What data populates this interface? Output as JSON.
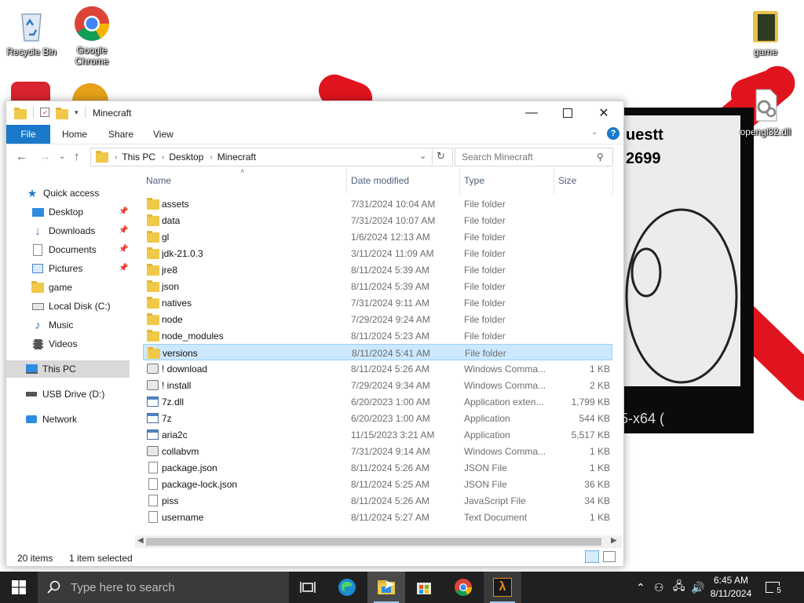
{
  "desktop": {
    "icons": [
      {
        "label": "Recycle Bin"
      },
      {
        "label": "Google Chrome"
      },
      {
        "label": "game"
      },
      {
        "label": "opengl32.dll"
      }
    ],
    "bg_window": {
      "line1": "uestt",
      "line2": "2699",
      "bottom": "5-x64 ("
    }
  },
  "explorer": {
    "title": "Minecraft",
    "ribbon_tabs": [
      "File",
      "Home",
      "Share",
      "View"
    ],
    "address": {
      "crumbs": [
        "This PC",
        "Desktop",
        "Minecraft"
      ]
    },
    "search_placeholder": "Search Minecraft",
    "nav": {
      "quick_access": "Quick access",
      "items": [
        {
          "label": "Desktop",
          "pinned": true
        },
        {
          "label": "Downloads",
          "pinned": true
        },
        {
          "label": "Documents",
          "pinned": true
        },
        {
          "label": "Pictures",
          "pinned": true
        },
        {
          "label": "game",
          "pinned": false
        },
        {
          "label": "Local Disk (C:)",
          "pinned": false
        },
        {
          "label": "Music",
          "pinned": false
        },
        {
          "label": "Videos",
          "pinned": false
        }
      ],
      "this_pc": "This PC",
      "usb": "USB Drive (D:)",
      "network": "Network"
    },
    "columns": {
      "name": "Name",
      "date": "Date modified",
      "type": "Type",
      "size": "Size"
    },
    "files": [
      {
        "name": "assets",
        "date": "7/31/2024 10:04 AM",
        "type": "File folder",
        "size": "",
        "icon": "folder"
      },
      {
        "name": "data",
        "date": "7/31/2024 10:07 AM",
        "type": "File folder",
        "size": "",
        "icon": "folder"
      },
      {
        "name": "gl",
        "date": "1/6/2024 12:13 AM",
        "type": "File folder",
        "size": "",
        "icon": "folder"
      },
      {
        "name": "jdk-21.0.3",
        "date": "3/11/2024 11:09 AM",
        "type": "File folder",
        "size": "",
        "icon": "folder"
      },
      {
        "name": "jre8",
        "date": "8/11/2024 5:39 AM",
        "type": "File folder",
        "size": "",
        "icon": "folder"
      },
      {
        "name": "json",
        "date": "8/11/2024 5:39 AM",
        "type": "File folder",
        "size": "",
        "icon": "folder"
      },
      {
        "name": "natives",
        "date": "7/31/2024 9:11 AM",
        "type": "File folder",
        "size": "",
        "icon": "folder"
      },
      {
        "name": "node",
        "date": "7/29/2024 9:24 AM",
        "type": "File folder",
        "size": "",
        "icon": "folder"
      },
      {
        "name": "node_modules",
        "date": "8/11/2024 5:23 AM",
        "type": "File folder",
        "size": "",
        "icon": "folder"
      },
      {
        "name": "versions",
        "date": "8/11/2024 5:41 AM",
        "type": "File folder",
        "size": "",
        "icon": "folder",
        "selected": true
      },
      {
        "name": "! download",
        "date": "8/11/2024 5:26 AM",
        "type": "Windows Comma...",
        "size": "1 KB",
        "icon": "cmd"
      },
      {
        "name": "! install",
        "date": "7/29/2024 9:34 AM",
        "type": "Windows Comma...",
        "size": "2 KB",
        "icon": "cmd"
      },
      {
        "name": "7z.dll",
        "date": "6/20/2023 1:00 AM",
        "type": "Application exten...",
        "size": "1,799 KB",
        "icon": "dll"
      },
      {
        "name": "7z",
        "date": "6/20/2023 1:00 AM",
        "type": "Application",
        "size": "544 KB",
        "icon": "app"
      },
      {
        "name": "aria2c",
        "date": "11/15/2023 3:21 AM",
        "type": "Application",
        "size": "5,517 KB",
        "icon": "app"
      },
      {
        "name": "collabvm",
        "date": "7/31/2024 9:14 AM",
        "type": "Windows Comma...",
        "size": "1 KB",
        "icon": "cmd"
      },
      {
        "name": "package.json",
        "date": "8/11/2024 5:26 AM",
        "type": "JSON File",
        "size": "1 KB",
        "icon": "file"
      },
      {
        "name": "package-lock.json",
        "date": "8/11/2024 5:25 AM",
        "type": "JSON File",
        "size": "36 KB",
        "icon": "file"
      },
      {
        "name": "piss",
        "date": "8/11/2024 5:26 AM",
        "type": "JavaScript File",
        "size": "34 KB",
        "icon": "js"
      },
      {
        "name": "username",
        "date": "8/11/2024 5:27 AM",
        "type": "Text Document",
        "size": "1 KB",
        "icon": "txt"
      }
    ],
    "status": {
      "count": "20 items",
      "selection": "1 item selected"
    }
  },
  "taskbar": {
    "search_placeholder": "Type here to search",
    "clock_time": "6:45 AM",
    "clock_date": "8/11/2024",
    "notification_count": "5"
  },
  "colors": {
    "accent": "#1979ca",
    "selection": "#cce8ff",
    "folder": "#f0c94a",
    "taskbar": "#202020",
    "red_marks": "#e0141e"
  }
}
